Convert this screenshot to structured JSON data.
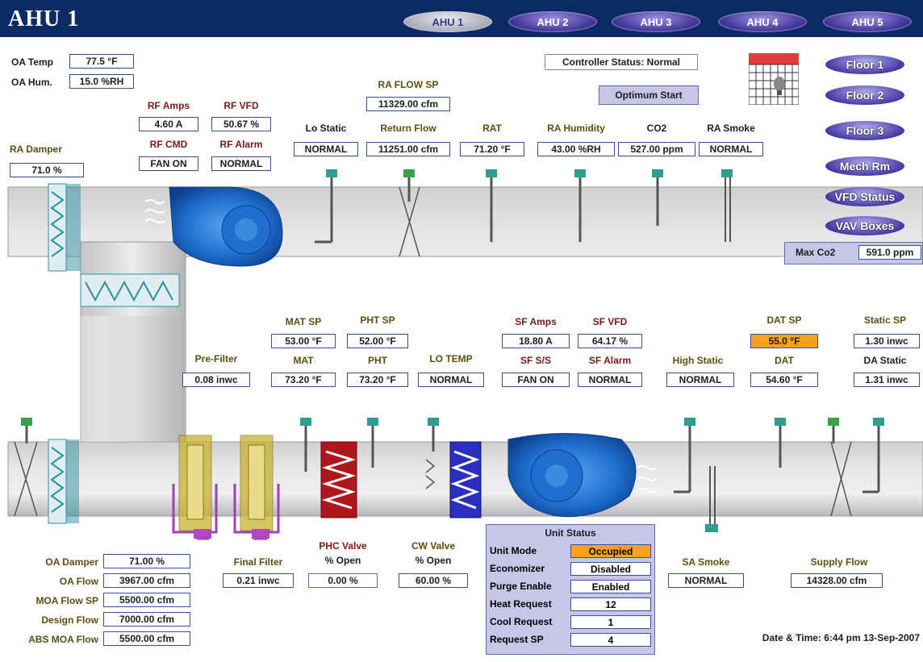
{
  "header": {
    "title": "AHU 1",
    "tabs": [
      "AHU 1",
      "AHU 2",
      "AHU 3",
      "AHU 4",
      "AHU 5"
    ]
  },
  "oa": {
    "temp_label": "OA Temp",
    "temp_value": "77.5 °F",
    "hum_label": "OA Hum.",
    "hum_value": "15.0 %RH"
  },
  "rf": {
    "amps_label": "RF Amps",
    "amps_value": "4.60 A",
    "vfd_label": "RF VFD",
    "vfd_value": "50.67 %",
    "cmd_label": "RF CMD",
    "cmd_value": "FAN ON",
    "alarm_label": "RF Alarm",
    "alarm_value": "NORMAL"
  },
  "ra_damper": {
    "label": "RA Damper",
    "value": "71.0 %"
  },
  "ra_flow_sp": {
    "label": "RA FLOW SP",
    "value": "11329.00 cfm"
  },
  "controller_status": "Controller Status: Normal",
  "optimum_start": "Optimum Start",
  "return_sensors": [
    {
      "label": "Lo Static",
      "value": "NORMAL"
    },
    {
      "label": "Return Flow",
      "value": "11251.00 cfm"
    },
    {
      "label": "RAT",
      "value": "71.20 °F"
    },
    {
      "label": "RA Humidity",
      "value": "43.00 %RH"
    },
    {
      "label": "CO2",
      "value": "527.00 ppm"
    },
    {
      "label": "RA Smoke",
      "value": "NORMAL"
    }
  ],
  "calendar_days": "S M T W T F S",
  "nav": [
    "Floor 1",
    "Floor 2",
    "Floor 3",
    "Mech Rm",
    "VFD Status",
    "VAV Boxes"
  ],
  "max_co2": {
    "label": "Max Co2",
    "value": "591.0 ppm"
  },
  "supply": {
    "mat_sp_label": "MAT SP",
    "mat_sp": "53.00 °F",
    "pht_sp_label": "PHT SP",
    "pht_sp": "52.00 °F",
    "prefilter_label": "Pre-Filter",
    "prefilter": "0.08 inwc",
    "mat_label": "MAT",
    "mat": "73.20 °F",
    "pht_label": "PHT",
    "pht": "73.20 °F",
    "lotemp_label": "LO TEMP",
    "lotemp": "NORMAL",
    "sf_amps_label": "SF Amps",
    "sf_amps": "18.80 A",
    "sf_vfd_label": "SF VFD",
    "sf_vfd": "64.17 %",
    "sf_ss_label": "SF S/S",
    "sf_ss": "FAN ON",
    "sf_alarm_label": "SF Alarm",
    "sf_alarm": "NORMAL",
    "high_static_label": "High Static",
    "high_static": "NORMAL",
    "dat_sp_label": "DAT SP",
    "dat_sp": "55.0 °F",
    "dat_label": "DAT",
    "dat": "54.60 °F",
    "static_sp_label": "Static SP",
    "static_sp": "1.30 inwc",
    "da_static_label": "DA Static",
    "da_static": "1.31 inwc"
  },
  "bottom": {
    "oa_damper_label": "OA Damper",
    "oa_damper": "71.00 %",
    "oa_flow_label": "OA Flow",
    "oa_flow": "3967.00 cfm",
    "moa_flow_sp_label": "MOA Flow SP",
    "moa_flow_sp": "5500.00 cfm",
    "design_flow_label": "Design Flow",
    "design_flow": "7000.00 cfm",
    "abs_moa_flow_label": "ABS MOA Flow",
    "abs_moa_flow": "5500.00 cfm",
    "final_filter_label": "Final Filter",
    "final_filter": "0.21 inwc",
    "phc_valve_label1": "PHC Valve",
    "phc_valve_label2": "% Open",
    "phc_valve": "0.00 %",
    "cw_valve_label1": "CW Valve",
    "cw_valve_label2": "% Open",
    "cw_valve": "60.00 %",
    "sa_smoke_label": "SA Smoke",
    "sa_smoke": "NORMAL",
    "supply_flow_label": "Supply Flow",
    "supply_flow": "14328.00 cfm"
  },
  "unit_status": {
    "title": "Unit Status",
    "rows": [
      {
        "label": "Unit Mode",
        "value": "Occupied"
      },
      {
        "label": "Economizer",
        "value": "Disabled"
      },
      {
        "label": "Purge Enable",
        "value": "Enabled"
      },
      {
        "label": "Heat Request",
        "value": "12"
      },
      {
        "label": "Cool Request",
        "value": "1"
      },
      {
        "label": "Request SP",
        "value": "4"
      }
    ]
  },
  "datetime": "Date & Time: 6:44 pm  13-Sep-2007",
  "colors": {
    "header_bg": "#0c2a63",
    "highlight": "#f7a11c",
    "fan": "#1f6fd0",
    "heating_coil": "#b0161c",
    "cooling_coil": "#2a2fc0",
    "filter": "#c9b230"
  }
}
